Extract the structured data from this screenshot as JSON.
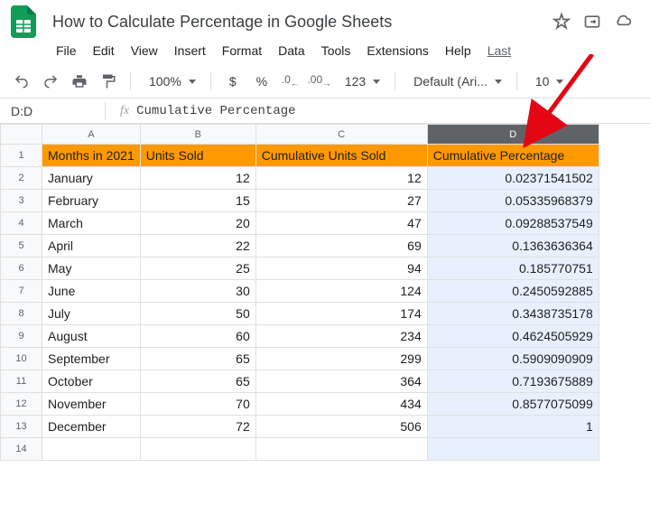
{
  "doc": {
    "title": "How to Calculate Percentage in Google Sheets"
  },
  "menu": {
    "file": "File",
    "edit": "Edit",
    "view": "View",
    "insert": "Insert",
    "format": "Format",
    "data": "Data",
    "tools": "Tools",
    "extensions": "Extensions",
    "help": "Help",
    "last": "Last"
  },
  "toolbar": {
    "zoom": "100%",
    "currency": "$",
    "percent": "%",
    "dec_dec": ".0",
    "inc_dec": ".00",
    "more_fmt": "123",
    "font": "Default (Ari...",
    "fontsize": "10"
  },
  "formula": {
    "cellref": "D:D",
    "fx": "fx",
    "value": "Cumulative Percentage"
  },
  "columns": {
    "a": "A",
    "b": "B",
    "c": "C",
    "d": "D"
  },
  "headers": {
    "a": "Months in 2021",
    "b": "Units Sold",
    "c": "Cumulative Units Sold",
    "d": "Cumulative Percentage"
  },
  "rows": [
    {
      "n": "1"
    },
    {
      "n": "2",
      "a": "January",
      "b": "12",
      "c": "12",
      "d": "0.02371541502"
    },
    {
      "n": "3",
      "a": "February",
      "b": "15",
      "c": "27",
      "d": "0.05335968379"
    },
    {
      "n": "4",
      "a": "March",
      "b": "20",
      "c": "47",
      "d": "0.09288537549"
    },
    {
      "n": "5",
      "a": "April",
      "b": "22",
      "c": "69",
      "d": "0.1363636364"
    },
    {
      "n": "6",
      "a": "May",
      "b": "25",
      "c": "94",
      "d": "0.185770751"
    },
    {
      "n": "7",
      "a": "June",
      "b": "30",
      "c": "124",
      "d": "0.2450592885"
    },
    {
      "n": "8",
      "a": "July",
      "b": "50",
      "c": "174",
      "d": "0.3438735178"
    },
    {
      "n": "9",
      "a": "August",
      "b": "60",
      "c": "234",
      "d": "0.4624505929"
    },
    {
      "n": "10",
      "a": "September",
      "b": "65",
      "c": "299",
      "d": "0.5909090909"
    },
    {
      "n": "11",
      "a": "October",
      "b": "65",
      "c": "364",
      "d": "0.7193675889"
    },
    {
      "n": "12",
      "a": "November",
      "b": "70",
      "c": "434",
      "d": "0.8577075099"
    },
    {
      "n": "13",
      "a": "December",
      "b": "72",
      "c": "506",
      "d": "1"
    },
    {
      "n": "14",
      "a": "",
      "b": "",
      "c": "",
      "d": ""
    }
  ]
}
